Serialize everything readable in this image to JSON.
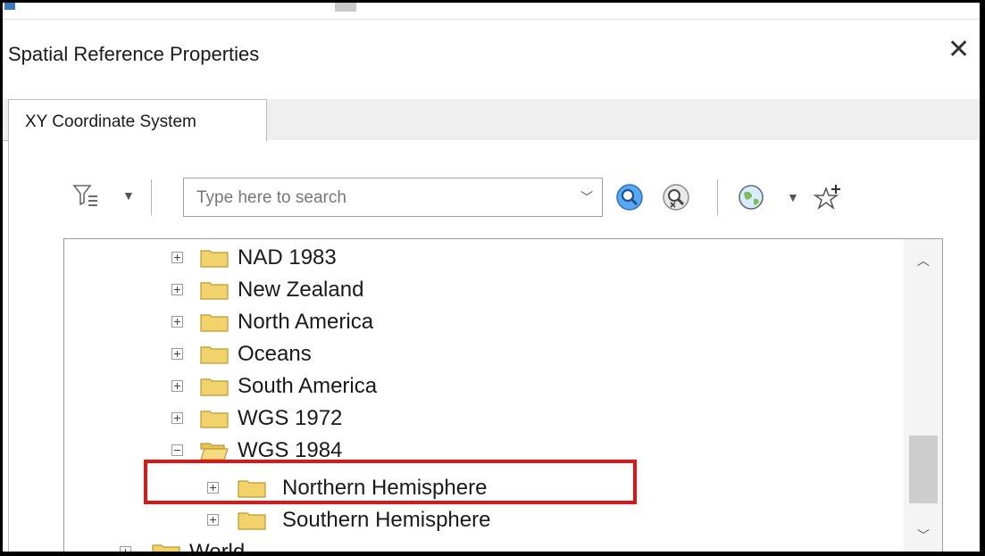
{
  "dialog": {
    "title": "Spatial Reference Properties",
    "close_glyph": "✕"
  },
  "tabs": [
    {
      "label": "XY Coordinate System",
      "active": true
    }
  ],
  "toolbar": {
    "filter_icon": "filter-icon",
    "search_placeholder": "Type here to search",
    "search_value": "",
    "search_button_icon": "search-icon",
    "clear_search_icon": "clear-search-icon",
    "globe_icon": "globe-icon",
    "add_favorite_icon": "add-favorite-icon"
  },
  "tree": {
    "items": [
      {
        "label": "NAD 1983",
        "expanded": false
      },
      {
        "label": "New Zealand",
        "expanded": false
      },
      {
        "label": "North America",
        "expanded": false
      },
      {
        "label": "Oceans",
        "expanded": false
      },
      {
        "label": "South America",
        "expanded": false
      },
      {
        "label": "WGS 1972",
        "expanded": false
      },
      {
        "label": "WGS 1984",
        "expanded": true
      },
      {
        "label": "Northern Hemisphere",
        "expanded": false,
        "highlighted": true
      },
      {
        "label": "Southern Hemisphere",
        "expanded": false
      },
      {
        "label": "World",
        "expanded": false
      }
    ]
  },
  "colors": {
    "highlight_border": "#e01515",
    "folder_fill": "#f2d36b",
    "search_icon": "#2f7fd6"
  }
}
